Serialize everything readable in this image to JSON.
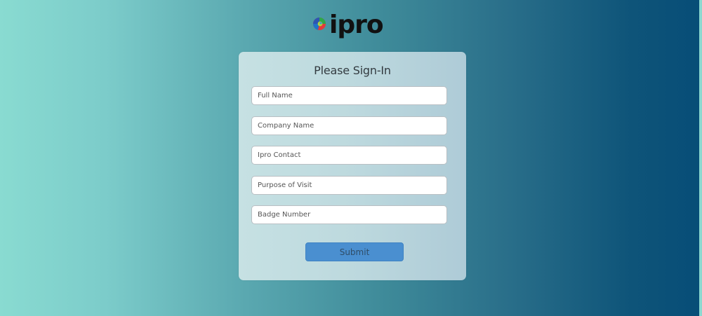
{
  "logo": {
    "text": "ipro",
    "icon": "ipro-swirl-icon"
  },
  "form": {
    "title": "Please Sign-In",
    "fields": [
      {
        "placeholder": "Full Name",
        "value": ""
      },
      {
        "placeholder": "Company Name",
        "value": ""
      },
      {
        "placeholder": "Ipro Contact",
        "value": ""
      },
      {
        "placeholder": "Purpose of Visit",
        "value": ""
      },
      {
        "placeholder": "Badge Number",
        "value": ""
      }
    ],
    "submit_label": "Submit"
  },
  "colors": {
    "bg_left": "#89dbd1",
    "bg_right": "#074d77",
    "button": "#4a8fd0"
  }
}
